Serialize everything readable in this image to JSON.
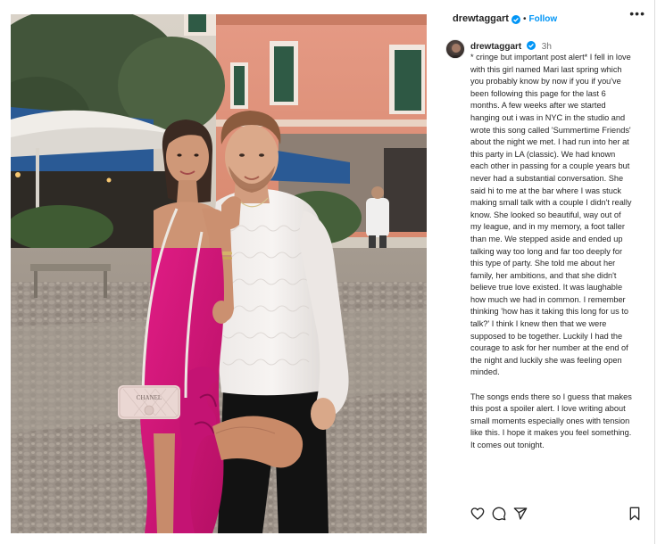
{
  "post": {
    "username": "drewtaggart",
    "follow_label": "Follow",
    "dot": "•",
    "more_label": "•••",
    "time": "3h",
    "caption": "* cringe but important post alert* I fell in love with this girl named Mari last spring which you probably know by now if you if you've been following this page for the last 6 months. A few weeks after we started hanging out i was in NYC in the studio and wrote this song called 'Summertime Friends' about the night we met. I had run into her at this party in LA (classic). We had known each other in passing for a couple years but never had a substantial conversation. She said hi to me at the bar where I was stuck making small talk with a couple I didn't really know. She looked so beautiful, way out of my league, and in my memory, a foot taller than me. We stepped aside and ended up talking way too long and far too deeply for this type of party. She told me about her family, her ambitions, and that she didn't believe true love existed. It was laughable how much we had in common. I remember thinking 'how has it taking this long for us to talk?' I think I knew then that we were supposed to be together. Luckily I had the courage to ask for her number at the end of the night and luckily she was feeling open minded.\n\nThe songs ends there so I guess that makes this post a spoiler alert. I love writing about small moments especially ones with tension like this. I hope it makes you feel something. It comes out tonight."
  },
  "photo": {
    "bag_text": "CHANEL"
  },
  "actions": {
    "icons": [
      "heart-icon",
      "comment-icon",
      "share-icon",
      "bookmark-icon"
    ]
  },
  "colors": {
    "accent": "#0095f6",
    "verified": "#0095f6",
    "dress": "#d6157a",
    "text": "#262626",
    "muted": "#737373"
  }
}
